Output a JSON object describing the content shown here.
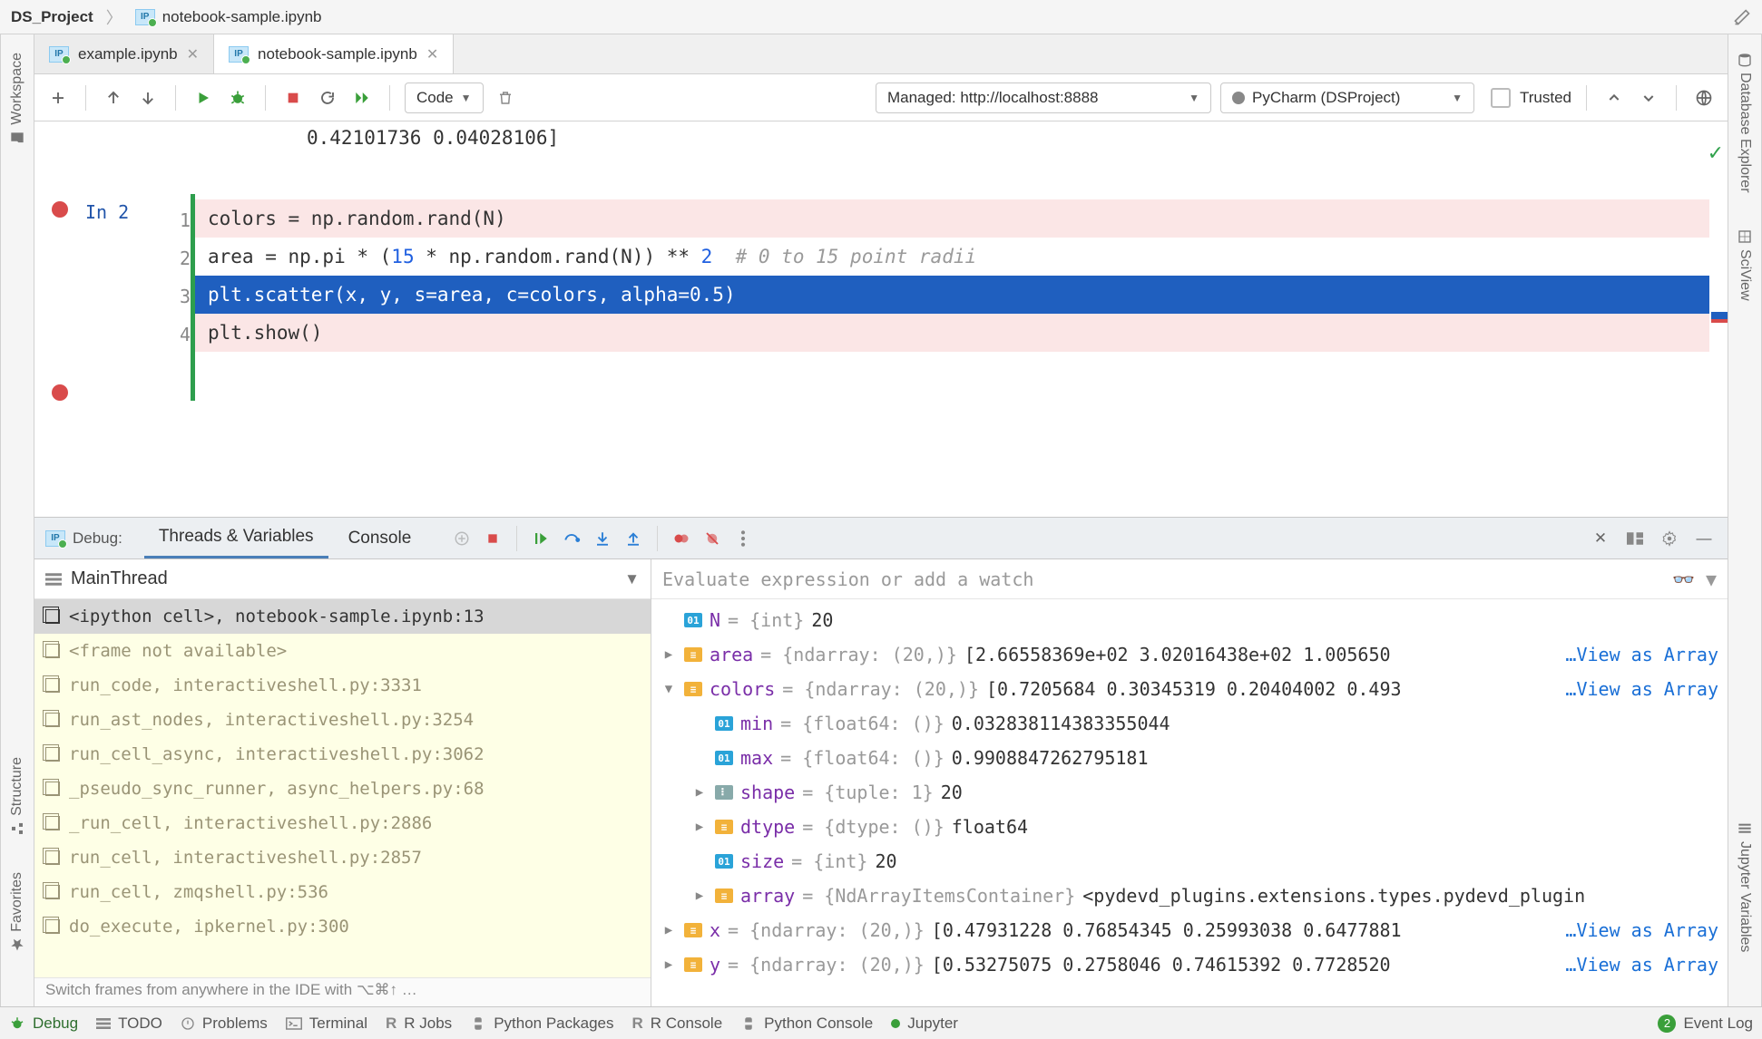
{
  "breadcrumb": {
    "project": "DS_Project",
    "file": "notebook-sample.ipynb"
  },
  "tabs": [
    {
      "label": "example.ipynb",
      "active": false
    },
    {
      "label": "notebook-sample.ipynb",
      "active": true
    }
  ],
  "nb_toolbar": {
    "cell_type": "Code",
    "server": "Managed: http://localhost:8888",
    "kernel": "PyCharm (DSProject)",
    "trusted": "Trusted"
  },
  "editor": {
    "prev_output": " 0.42101736 0.04028106]",
    "prompt": "In 2",
    "line_numbers": [
      "1",
      "2",
      "3",
      "4"
    ],
    "code": {
      "l1": "colors = np.random.rand(N)",
      "l2a": "area = np.pi * (",
      "l2b": "15",
      "l2c": " * np.random.rand(N)) ** ",
      "l2d": "2",
      "l2e": "  # 0 to 15 point radii",
      "l3": "plt.scatter(x, y, s=area, c=colors, alpha=0.5)",
      "l4": "plt.show()"
    }
  },
  "debug": {
    "title": "Debug:",
    "tab_threads": "Threads & Variables",
    "tab_console": "Console",
    "thread": "MainThread",
    "eval_placeholder": "Evaluate expression or add a watch",
    "frames": [
      "<ipython cell>, notebook-sample.ipynb:13",
      "<frame not available>",
      "run_code, interactiveshell.py:3331",
      "run_ast_nodes, interactiveshell.py:3254",
      "run_cell_async, interactiveshell.py:3062",
      "_pseudo_sync_runner, async_helpers.py:68",
      "_run_cell, interactiveshell.py:2886",
      "run_cell, interactiveshell.py:2857",
      "run_cell, zmqshell.py:536",
      "do_execute, ipkernel.py:300"
    ],
    "frames_tip": "Switch frames from anywhere in the IDE with ⌥⌘↑ …",
    "vars": {
      "N": {
        "name": "N",
        "type": " = {int} ",
        "val": "20"
      },
      "area": {
        "name": "area",
        "type": " = {ndarray: (20,)} ",
        "val": "[2.66558369e+02 3.02016438e+02 1.005650",
        "link": "…View as Array"
      },
      "colors": {
        "name": "colors",
        "type": " = {ndarray: (20,)} ",
        "val": "[0.7205684  0.30345319 0.20404002 0.493",
        "link": "…View as Array"
      },
      "min": {
        "name": "min",
        "type": " = {float64: ()} ",
        "val": "0.032838114383355044"
      },
      "max": {
        "name": "max",
        "type": " = {float64: ()} ",
        "val": "0.9908847262795181"
      },
      "shape": {
        "name": "shape",
        "type": " = {tuple: 1} ",
        "val": "20"
      },
      "dtype": {
        "name": "dtype",
        "type": " = {dtype: ()} ",
        "val": "float64"
      },
      "size": {
        "name": "size",
        "type": " = {int} ",
        "val": "20"
      },
      "array": {
        "name": "array",
        "type": " = {NdArrayItemsContainer} ",
        "val": "<pydevd_plugins.extensions.types.pydevd_plugin"
      },
      "x": {
        "name": "x",
        "type": " = {ndarray: (20,)} ",
        "val": "[0.47931228 0.76854345 0.25993038 0.6477881",
        "link": "…View as Array"
      },
      "y": {
        "name": "y",
        "type": " = {ndarray: (20,)} ",
        "val": "[0.53275075 0.2758046  0.74615392 0.7728520",
        "link": "…View as Array"
      }
    }
  },
  "left_rail": {
    "workspace": "Workspace",
    "structure": "Structure",
    "favorites": "Favorites"
  },
  "right_rail": {
    "db": "Database Explorer",
    "sci": "SciView",
    "jupvar": "Jupyter Variables"
  },
  "status": {
    "debug": "Debug",
    "todo": "TODO",
    "problems": "Problems",
    "terminal": "Terminal",
    "rjobs": "R Jobs",
    "pypkg": "Python Packages",
    "rconsole": "R Console",
    "pyconsole": "Python Console",
    "jupyter": "Jupyter",
    "eventlog": "Event Log",
    "eventcount": "2"
  }
}
